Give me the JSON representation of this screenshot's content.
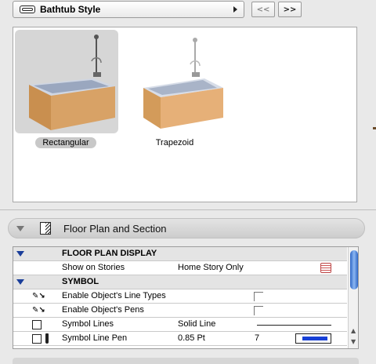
{
  "style_picker": {
    "label": "Bathtub Style"
  },
  "nav": {
    "prev_label": "<<",
    "next_label": ">>"
  },
  "gallery": {
    "items": [
      {
        "label": "Rectangular",
        "selected": true
      },
      {
        "label": "Trapezoid",
        "selected": false
      }
    ]
  },
  "section": {
    "title": "Floor Plan and Section"
  },
  "table": {
    "floor_plan_display": {
      "label": "FLOOR PLAN DISPLAY"
    },
    "show_on_stories": {
      "name": "Show on Stories",
      "value": "Home Story Only"
    },
    "symbol": {
      "label": "SYMBOL"
    },
    "line_types": {
      "name": "Enable Object's Line Types"
    },
    "pens": {
      "name": "Enable Object's Pens"
    },
    "symbol_lines": {
      "name": "Symbol Lines",
      "value": "Solid Line"
    },
    "symbol_line_pen": {
      "name": "Symbol Line Pen",
      "value": "0.85 Pt",
      "pen_number": "7",
      "pen_color": "#1740d6"
    }
  },
  "colors": {
    "scroll_accent": "#2f67c6",
    "group_triangle": "#1a3e9a"
  }
}
